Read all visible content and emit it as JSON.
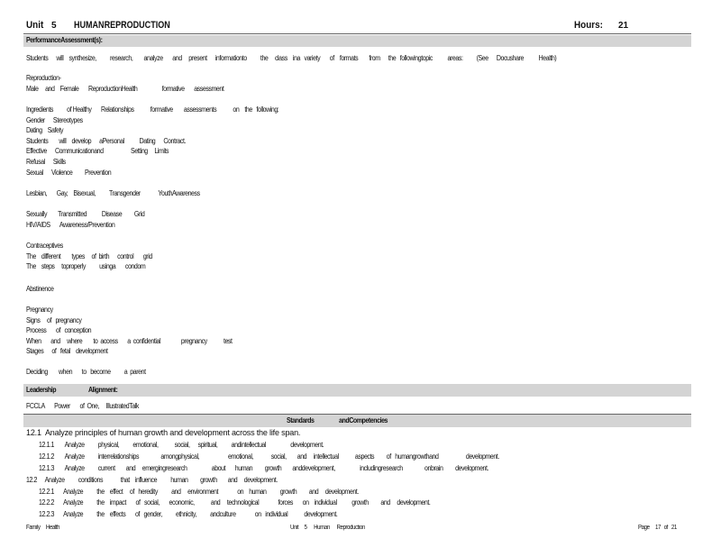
{
  "header": {
    "unit_label": "Unit",
    "unit_number": "5",
    "unit_title": "HUMANREPRODUCTION",
    "hours_label": "Hours:",
    "hours_value": "21"
  },
  "performance": {
    "heading": "PerformanceAssessment(s):",
    "intro": "Students      will    synthesize,          research,        analyze       and     present      informationto          the     class    ina   variety       of    formats        from      the   followingtopic           areas:          (See      Docushare           Health)",
    "groups": [
      [
        "Reproduction-",
        "Male     and    Female       ReproductionHealth                  formative       assessment"
      ],
      [
        "Ingredients          of Healthy       Relationships            formative        assessments            on    the   following:",
        "Gender      Stereotypes",
        "Dating    Safety",
        "Students        will    develop      aPersonal           Dating      Contract.",
        "Effective      Communicationand                    Setting     Limits",
        "Refusal      Skills",
        "Sexual      Violence         Prevention"
      ],
      [
        "Lesbian,       Gay,    Bisexual,          Transgender             YouthAwareness"
      ],
      [
        "Sexually        Transmitted           Disease         Grid",
        "HIV/AIDS       Awareness/Prevention"
      ],
      [
        "Contraceptives",
        "The    different        types     of  birth      control       grid",
        "The    steps     toproperly          usinga       condom"
      ],
      [
        "Abstinence"
      ],
      [
        "Pregnancy",
        "Signs     of   pregnancy",
        "Process       of   conception",
        "When       and     where        to  access       a  confidential               pregnancy            test",
        "Stages      of   fetal    development"
      ],
      [
        "Deciding        when       to   become          a  parent"
      ]
    ]
  },
  "leadership": {
    "heading_a": "Leadership",
    "heading_b": "Alignment:",
    "text": "FCCLA       Power       of  One,     IllustratedTalk"
  },
  "standards": {
    "heading_a": "Standards",
    "heading_b": "andCompetencies",
    "items": [
      {
        "indent": 0,
        "big": true,
        "text": "12.1  Analyze principles of human growth and development across the life span."
      },
      {
        "indent": 1,
        "big": false,
        "text": "12.1.1        Analyze          physical,          emotional,            social,      spiritual,          andintellectual                  development."
      },
      {
        "indent": 1,
        "big": false,
        "text": "12.1.2        Analyze          interrelationships                amongphysical,                     emotional,             social,        and     intellectual            aspects         of   humangrowthand                    development."
      },
      {
        "indent": 1,
        "big": false,
        "text": "12.1.3        Analyze          current        and     emergingresearch                  about       human         growth        anddevelopment,                  includingresearch                onbrain         development."
      },
      {
        "indent": 0,
        "big": false,
        "text": "12.2      Analyze          conditions             that    influence          human         growth        and     development."
      },
      {
        "indent": 1,
        "big": false,
        "text": "12.2.1       Analyze          the    effect     of   heredity          and     environment              on    human          growth         and     development."
      },
      {
        "indent": 1,
        "big": false,
        "text": "12.2.2       Analyze          the    impact       of   social,       economic,            and     technological              forces       on    individual           growth         and     development."
      },
      {
        "indent": 1,
        "big": false,
        "text": "12.2.3       Analyze          the    effects       of   gender,          ethnicity,          andculture              on   individual            development."
      }
    ]
  },
  "footer": {
    "left": "Family     Health",
    "center": "Unit     5      Human      Reproduction",
    "right": "Page     17   of   21"
  }
}
